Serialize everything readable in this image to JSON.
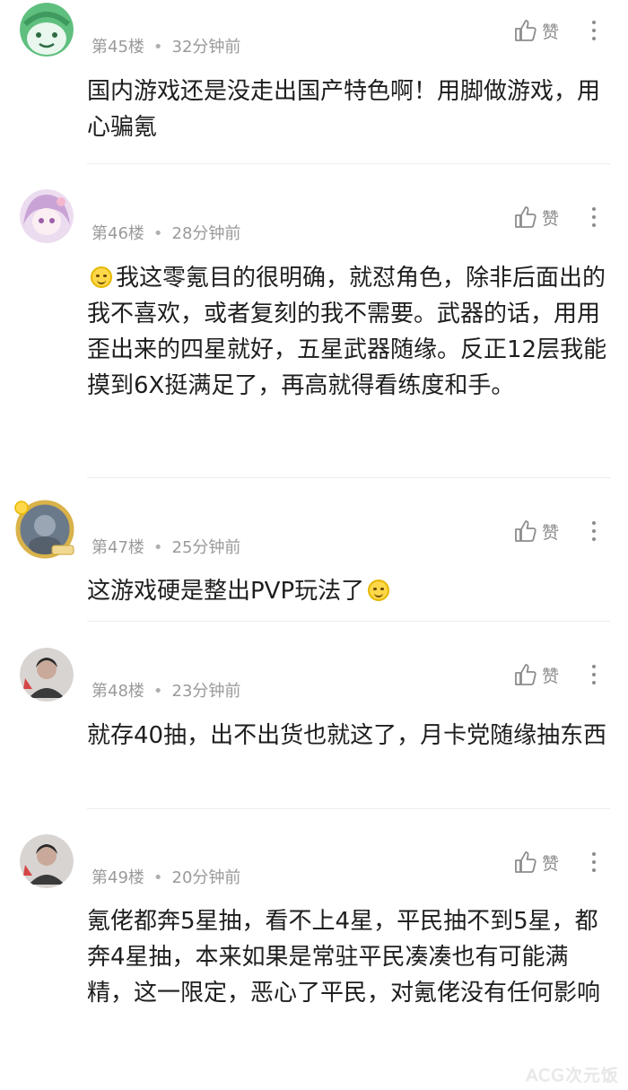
{
  "like_label": "赞",
  "comments": [
    {
      "floor": "第45楼",
      "time": "32分钟前",
      "text": "国内游戏还是没走出国产特色啊！用脚做游戏，用心骗氪",
      "avatar": "green-face-avatar"
    },
    {
      "floor": "第46楼",
      "time": "28分钟前",
      "text": "我这零氪目的很明确，就怼角色，除非后面出的我不喜欢，或者复刻的我不需要。武器的话，用用歪出来的四星就好，五星武器随缘。反正12层我能摸到6X挺满足了，再高就得看练度和手。",
      "avatar": "anime-girl-avatar",
      "lead_emoji": "smile-emoji"
    },
    {
      "floor": "第47楼",
      "time": "25分钟前",
      "text": "这游戏硬是整出PVP玩法了",
      "avatar": "badge-framed-avatar",
      "trail_emoji": "smile-emoji"
    },
    {
      "floor": "第48楼",
      "time": "23分钟前",
      "text": "就存40抽，出不出货也就这了，月卡党随缘抽东西",
      "avatar": "person-photo-avatar"
    },
    {
      "floor": "第49楼",
      "time": "20分钟前",
      "text": "氪佬都奔5星抽，看不上4星，平民抽不到5星，都奔4星抽，本来如果是常驻平民凑凑也有可能满精，这一限定，恶心了平民，对氪佬没有任何影响",
      "avatar": "person-photo-avatar"
    }
  ],
  "watermark": "ACG次元饭",
  "colors": {
    "meta": "#9a9a9a",
    "text": "#1e1e1e",
    "divider": "#ececec",
    "icon": "#8c8c8c"
  }
}
